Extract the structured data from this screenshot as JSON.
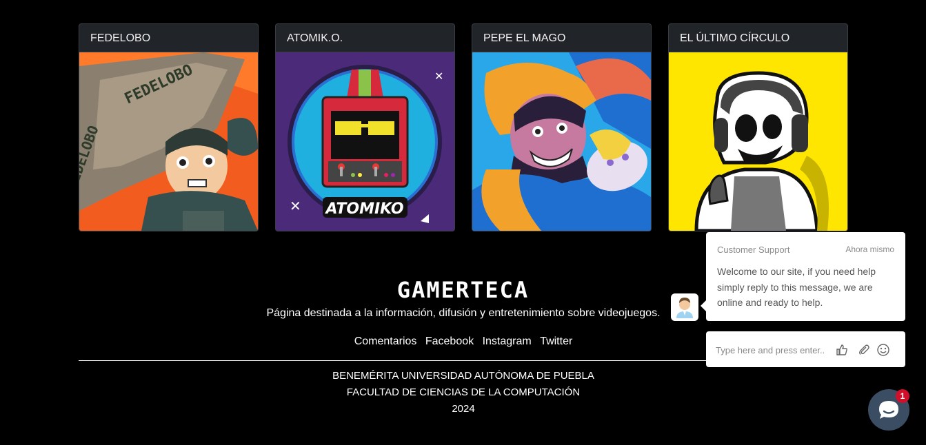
{
  "cards": [
    {
      "title": "FEDELOBO",
      "image_text": "FEDELOBO"
    },
    {
      "title": "ATOMIK.O.",
      "image_text": "ATOMIKO"
    },
    {
      "title": "PEPE EL MAGO"
    },
    {
      "title": "EL ÚLTIMO CÍRCULO"
    }
  ],
  "footer": {
    "site_title": "GAMERTECA",
    "description": "Página destinada a la información, difusión y entretenimiento sobre videojuegos.",
    "links": [
      "Comentarios",
      "Facebook",
      "Instagram",
      "Twitter"
    ],
    "university": "BENEMÉRITA UNIVERSIDAD AUTÓNOMA DE PUEBLA",
    "faculty": "FACULTAD DE CIENCIAS DE LA COMPUTACIÓN",
    "year": "2024"
  },
  "chat": {
    "agent_name": "Customer Support",
    "time": "Ahora mismo",
    "message": "Welcome to our site, if you need help simply reply to this message, we are online and ready to help.",
    "input_placeholder": "Type here and press enter..",
    "icons": [
      "thumbs-up-icon",
      "paperclip-icon",
      "smiley-icon"
    ],
    "launcher_badge": "1"
  },
  "colors": {
    "background": "#000000",
    "card_header": "#212529",
    "launcher": "#3a4d63",
    "badge": "#d0102a"
  }
}
